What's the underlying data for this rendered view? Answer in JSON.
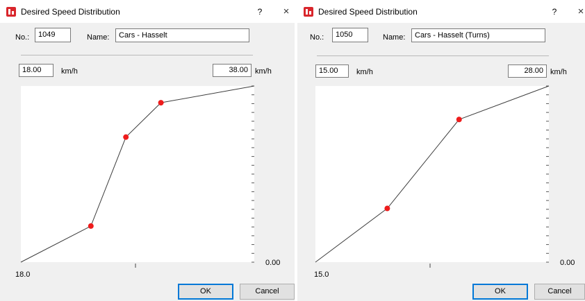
{
  "dialogs": [
    {
      "title": "Desired Speed Distribution",
      "help_label": "?",
      "close_label": "×",
      "no_label": "No.:",
      "no_value": "1049",
      "name_label": "Name:",
      "name_value": "Cars - Hasselt",
      "min_speed": "18.00",
      "max_speed": "38.00",
      "unit": "km/h",
      "y_axis_min_label": "0.00",
      "x_axis_min_label": "18.0",
      "ok_label": "OK",
      "cancel_label": "Cancel",
      "curve_points": [
        {
          "speed": 18.0,
          "share": 0.0
        },
        {
          "speed": 24.0,
          "share": 0.205
        },
        {
          "speed": 27.0,
          "share": 0.71
        },
        {
          "speed": 30.0,
          "share": 0.905
        },
        {
          "speed": 38.0,
          "share": 1.0
        }
      ],
      "control_points": [
        1,
        2,
        3
      ]
    },
    {
      "title": "Desired Speed Distribution",
      "help_label": "?",
      "close_label": "×",
      "no_label": "No.:",
      "no_value": "1050",
      "name_label": "Name:",
      "name_value": "Cars - Hasselt (Turns)",
      "min_speed": "15.00",
      "max_speed": "28.00",
      "unit": "km/h",
      "y_axis_min_label": "0.00",
      "x_axis_min_label": "15.0",
      "ok_label": "OK",
      "cancel_label": "Cancel",
      "curve_points": [
        {
          "speed": 15.0,
          "share": 0.0
        },
        {
          "speed": 19.0,
          "share": 0.305
        },
        {
          "speed": 23.0,
          "share": 0.81
        },
        {
          "speed": 28.0,
          "share": 1.0
        }
      ],
      "control_points": [
        1,
        2
      ]
    }
  ],
  "colors": {
    "control_point": "#ee1c1c",
    "curve": "#3c3c3c"
  }
}
